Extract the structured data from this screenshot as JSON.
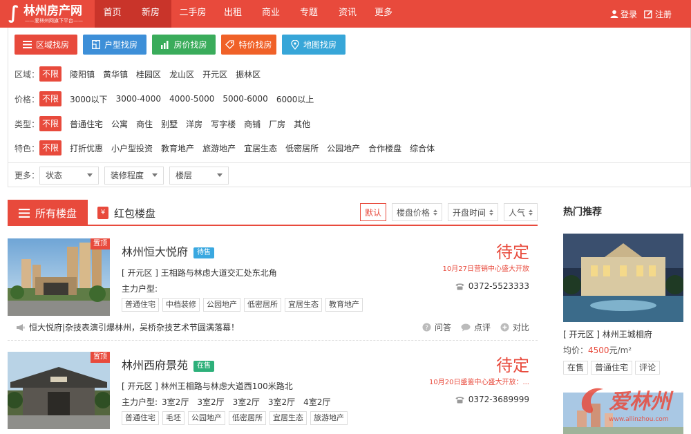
{
  "brand": {
    "name": "林州房产网",
    "slogan": "——爱林州网旗下平台——"
  },
  "nav": [
    {
      "label": "首页"
    },
    {
      "label": "新房",
      "active": true
    },
    {
      "label": "二手房"
    },
    {
      "label": "出租"
    },
    {
      "label": "商业"
    },
    {
      "label": "专题"
    },
    {
      "label": "资讯"
    },
    {
      "label": "更多"
    }
  ],
  "auth": {
    "login": "登录",
    "register": "注册"
  },
  "search_tabs": [
    {
      "label": "区域找房",
      "color": "#e84a3c",
      "icon": "list-icon"
    },
    {
      "label": "户型找房",
      "color": "#3d8fd8",
      "icon": "floorplan-icon"
    },
    {
      "label": "房价找房",
      "color": "#3aac5b",
      "icon": "bar-chart-icon"
    },
    {
      "label": "特价找房",
      "color": "#f06128",
      "icon": "tag-icon"
    },
    {
      "label": "地图找房",
      "color": "#37a6d8",
      "icon": "map-pin-icon"
    }
  ],
  "filters": [
    {
      "label": "区域：",
      "options": [
        "不限",
        "陵阳镇",
        "黄华镇",
        "桂园区",
        "龙山区",
        "开元区",
        "振林区"
      ]
    },
    {
      "label": "价格：",
      "options": [
        "不限",
        "3000以下",
        "3000-4000",
        "4000-5000",
        "5000-6000",
        "6000以上"
      ]
    },
    {
      "label": "类型：",
      "options": [
        "不限",
        "普通住宅",
        "公寓",
        "商住",
        "别墅",
        "洋房",
        "写字楼",
        "商铺",
        "厂房",
        "其他"
      ]
    },
    {
      "label": "特色：",
      "options": [
        "不限",
        "打折优惠",
        "小户型投资",
        "教育地产",
        "旅游地产",
        "宜居生态",
        "低密居所",
        "公园地产",
        "合作楼盘",
        "综合体"
      ]
    }
  ],
  "more": {
    "label": "更多：",
    "dropdowns": [
      "状态",
      "装修程度",
      "楼层"
    ]
  },
  "list_header": {
    "all": "所有楼盘",
    "red": "红包楼盘",
    "red_icon_text": "¥",
    "sorts": [
      "默认",
      "楼盘价格",
      "开盘时间",
      "人气"
    ]
  },
  "listings": [
    {
      "name": "林州恒大悦府",
      "status": "待售",
      "status_color": "#3aa8e0",
      "top_tag": "置顶",
      "address": "[ 开元区 ] 王相路与林虑大道交汇处东北角",
      "huxing_label": "主力户型:",
      "huxing": [],
      "tags": [
        "普通住宅",
        "中档装修",
        "公园地产",
        "低密居所",
        "宜居生态",
        "教育地产"
      ],
      "price": "待定",
      "promo": "10月27日营销中心盛大开放",
      "phone": "0372-5523333",
      "news": "恒大悦府|杂技表演引爆林州，吴桥杂技艺术节圆满落幕！",
      "actions": [
        "问答",
        "点评",
        "对比"
      ]
    },
    {
      "name": "林州西府景苑",
      "status": "在售",
      "status_color": "#2db07a",
      "top_tag": "置顶",
      "address": "[ 开元区 ] 林州王相路与林虑大道西100米路北",
      "huxing_label": "主力户型:",
      "huxing": [
        "3室2厅",
        "3室2厅",
        "3室2厅",
        "3室2厅",
        "4室2厅"
      ],
      "tags": [
        "普通住宅",
        "毛坯",
        "公园地产",
        "低密居所",
        "宜居生态",
        "旅游地产"
      ],
      "price": "待定",
      "promo": "10月20日盛鉴中心盛大开放：...",
      "phone": "0372-3689999"
    }
  ],
  "sidebar": {
    "title": "热门推荐",
    "item": {
      "name": "[ 开元区 ]   林州王城相府",
      "price_label": "均价：",
      "price": "4500",
      "price_unit": "元/m²",
      "tags": [
        "在售",
        "普通住宅",
        "评论"
      ]
    }
  },
  "watermark": {
    "text": "爱林州",
    "url": "www.allinzhou.com"
  },
  "colors": {
    "accent": "#e84a3c"
  }
}
